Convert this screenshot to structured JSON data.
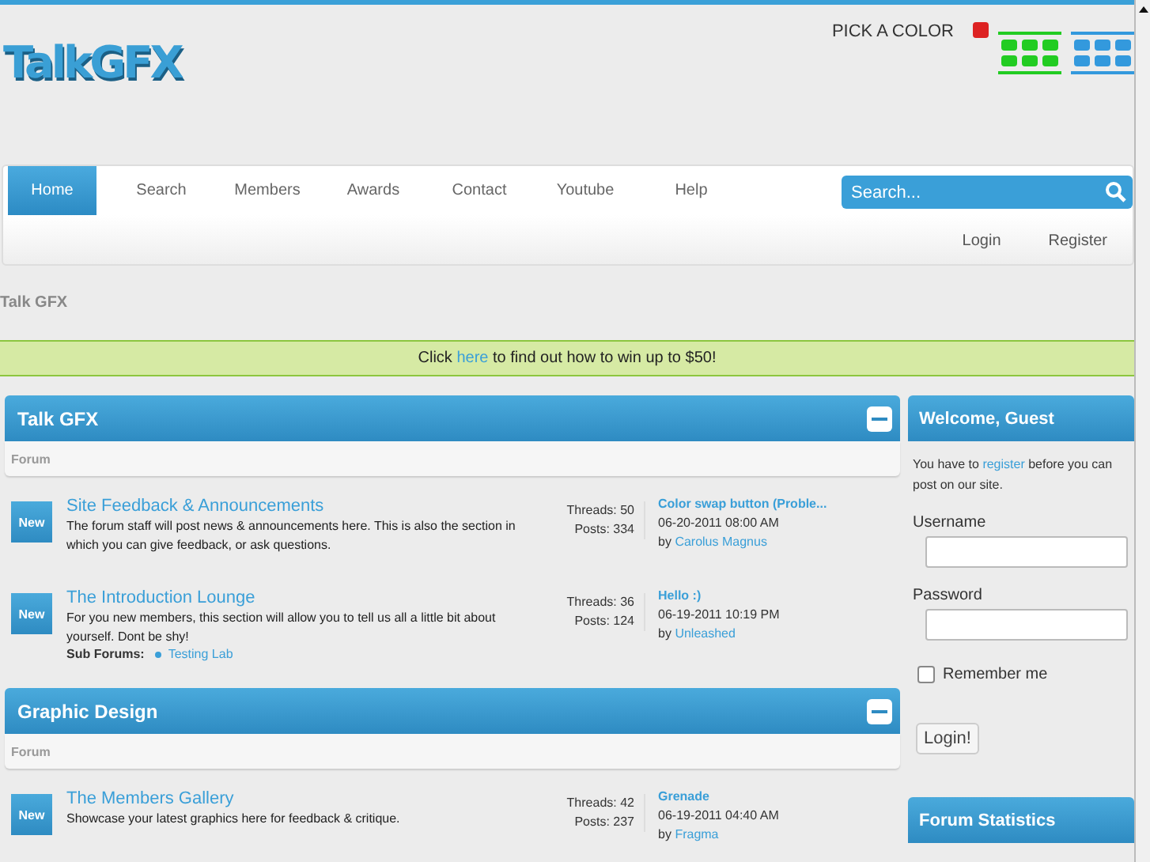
{
  "logo": {
    "text": "TalkGFX"
  },
  "color_picker": {
    "label": "PICK A COLOR",
    "swatches": [
      {
        "color": "#dd2222",
        "kind": "single"
      },
      {
        "color": "#22cc22",
        "kind": "grid"
      },
      {
        "color": "#3399dd",
        "kind": "grid"
      }
    ]
  },
  "nav": {
    "tabs": [
      {
        "label": "Home",
        "selected": true
      },
      {
        "label": "Search",
        "selected": false
      },
      {
        "label": "Members",
        "selected": false
      },
      {
        "label": "Awards",
        "selected": false
      },
      {
        "label": "Contact",
        "selected": false
      },
      {
        "label": "Youtube",
        "selected": false
      },
      {
        "label": "Help",
        "selected": false
      }
    ],
    "search": {
      "placeholder": "Search..."
    },
    "user_links": [
      "Login",
      "Register"
    ]
  },
  "breadcrumb": "Talk GFX",
  "banner": {
    "before": "Click",
    "link": "here",
    "after": "to find out how to win up to $50!"
  },
  "categories": [
    {
      "title": "Talk GFX",
      "column": "Forum",
      "forums": [
        {
          "badge": "New",
          "title": "Site Feedback & Announcements",
          "description": "The forum staff will post news & announcements here. This is also the section in which you can give feedback, or ask questions.",
          "threads": "Threads: 50",
          "posts": "Posts: 334",
          "last_post": {
            "title": "Color swap button (Proble...",
            "date": "06-20-2011 08:00 AM",
            "by": "by",
            "author": "Carolus Magnus"
          }
        },
        {
          "badge": "New",
          "title": "The Introduction Lounge",
          "description": "For you new members, this section will allow you to tell us all a little bit about yourself. Dont be shy!",
          "sub_forums": {
            "label": "Sub Forums:",
            "items": [
              "Testing Lab"
            ]
          },
          "threads": "Threads: 36",
          "posts": "Posts: 124",
          "last_post": {
            "title": "Hello :)",
            "date": "06-19-2011 10:19 PM",
            "by": "by",
            "author": "Unleashed"
          }
        }
      ]
    },
    {
      "title": "Graphic Design",
      "column": "Forum",
      "forums": [
        {
          "badge": "New",
          "title": "The Members Gallery",
          "description": "Showcase your latest graphics here for feedback & critique.",
          "threads": "Threads: 42",
          "posts": "Posts: 237",
          "last_post": {
            "title": "Grenade",
            "date": "06-19-2011 04:40 AM",
            "by": "by",
            "author": "Fragma"
          }
        }
      ]
    }
  ],
  "sidebar": {
    "welcome": {
      "title": "Welcome, Guest",
      "text_before": "You have to",
      "link": "register",
      "text_after": "before you can post on our site.",
      "username_label": "Username",
      "password_label": "Password",
      "remember": {
        "label": "Remember me",
        "checked": false
      },
      "button": "Login!"
    },
    "next_panel": "Forum Statistics"
  }
}
